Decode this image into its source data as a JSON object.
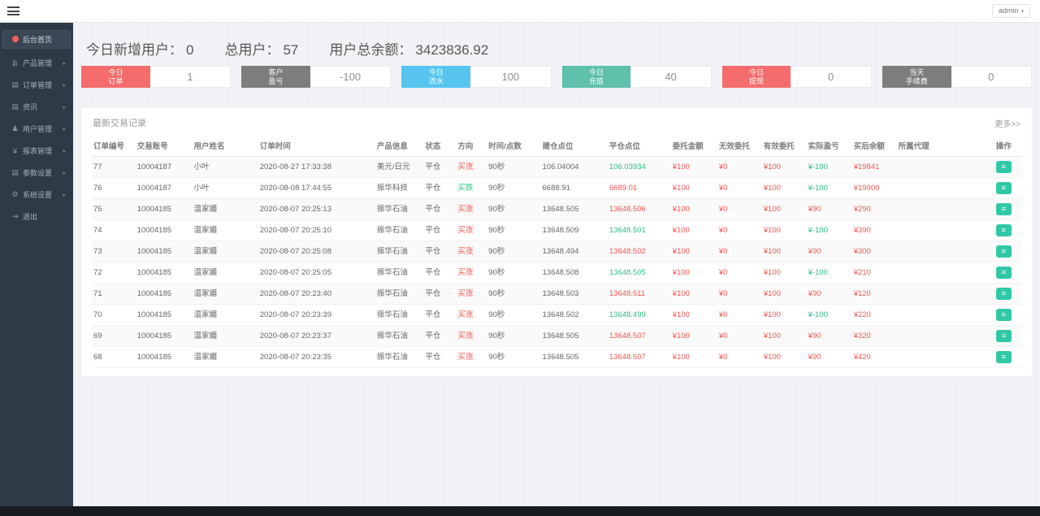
{
  "topbar": {
    "user_menu": "admin"
  },
  "sidebar": {
    "items": [
      {
        "label": "后台首页",
        "icon": "dashboard-icon",
        "glyph": "",
        "active": true,
        "has_children": false
      },
      {
        "label": "产品管理",
        "icon": "product-icon",
        "glyph": "Ƀ",
        "active": false,
        "has_children": true
      },
      {
        "label": "订单管理",
        "icon": "orders-icon",
        "glyph": "▤",
        "active": false,
        "has_children": true
      },
      {
        "label": "资讯",
        "icon": "news-icon",
        "glyph": "▤",
        "active": false,
        "has_children": true
      },
      {
        "label": "用户管理",
        "icon": "user-icon",
        "glyph": "♟",
        "active": false,
        "has_children": true
      },
      {
        "label": "报表管理",
        "icon": "report-yen-icon",
        "glyph": "¥",
        "active": false,
        "has_children": true
      },
      {
        "label": "参数设置",
        "icon": "params-icon",
        "glyph": "▤",
        "active": false,
        "has_children": true
      },
      {
        "label": "系统设置",
        "icon": "settings-gear-icon",
        "glyph": "⚙",
        "active": false,
        "has_children": true
      },
      {
        "label": "退出",
        "icon": "logout-icon",
        "glyph": "⇥",
        "active": false,
        "has_children": false
      }
    ]
  },
  "summary": {
    "items": [
      {
        "label": "今日新增用户：",
        "value": "0"
      },
      {
        "label": "总用户：",
        "value": "57"
      },
      {
        "label": "用户总余额：",
        "value": "3423836.92"
      }
    ]
  },
  "stat_cards": [
    {
      "name": "today-orders",
      "label_lines": [
        "今日",
        "订单"
      ],
      "value": "1",
      "color": "#f56c6c"
    },
    {
      "name": "customer-pnl",
      "label_lines": [
        "客户",
        "盈亏"
      ],
      "value": "-100",
      "color": "#7d7d7d"
    },
    {
      "name": "today-turnover",
      "label_lines": [
        "今日",
        "流水"
      ],
      "value": "100",
      "color": "#57c5f0"
    },
    {
      "name": "today-deposit",
      "label_lines": [
        "今日",
        "充值"
      ],
      "value": "40",
      "color": "#5fc0ab"
    },
    {
      "name": "today-withdrawal",
      "label_lines": [
        "今日",
        "提现"
      ],
      "value": "0",
      "color": "#f56c6c"
    },
    {
      "name": "today-fees",
      "label_lines": [
        "当天",
        "手续费"
      ],
      "value": "0",
      "color": "#7d7d7d"
    }
  ],
  "table": {
    "title": "最新交易记录",
    "more_label": "更多>>",
    "columns": [
      {
        "label": "订单编号",
        "w": "4.7%"
      },
      {
        "label": "交易账号",
        "w": "6.1%"
      },
      {
        "label": "用户姓名",
        "w": "7.1%"
      },
      {
        "label": "订单时间",
        "w": "12.6%"
      },
      {
        "label": "产品信息",
        "w": "5.2%"
      },
      {
        "label": "状态",
        "w": "3.5%"
      },
      {
        "label": "方向",
        "w": "3.3%"
      },
      {
        "label": "时间/点数",
        "w": "5.8%"
      },
      {
        "label": "建仓点位",
        "w": "7.2%"
      },
      {
        "label": "平仓点位",
        "w": "6.8%"
      },
      {
        "label": "委托金额",
        "w": "5.0%"
      },
      {
        "label": "无效委托",
        "w": "4.8%"
      },
      {
        "label": "有效委托",
        "w": "4.8%"
      },
      {
        "label": "实际盈亏",
        "w": "4.9%"
      },
      {
        "label": "买后余额",
        "w": "4.8%"
      },
      {
        "label": "所属代理",
        "w": "10.5%"
      },
      {
        "label": "操作",
        "w": "2.9%"
      }
    ],
    "action_icon": "order-detail-button",
    "rows": [
      {
        "cells": [
          {
            "v": "77"
          },
          {
            "v": "10004187"
          },
          {
            "v": "小叶"
          },
          {
            "v": "2020-08-27 17:33:38"
          },
          {
            "v": "美元/日元"
          },
          {
            "v": "平仓"
          },
          {
            "v": "买涨",
            "c": "red"
          },
          {
            "v": "90秒"
          },
          {
            "v": "106.04004"
          },
          {
            "v": "106.03934",
            "c": "green"
          },
          {
            "v": "¥100",
            "c": "red"
          },
          {
            "v": "¥0",
            "c": "red"
          },
          {
            "v": "¥100",
            "c": "red"
          },
          {
            "v": "¥-100",
            "c": "green"
          },
          {
            "v": "¥19841",
            "c": "red"
          },
          {
            "v": ""
          }
        ]
      },
      {
        "cells": [
          {
            "v": "76"
          },
          {
            "v": "10004187"
          },
          {
            "v": "小叶"
          },
          {
            "v": "2020-08-08 17:44:55"
          },
          {
            "v": "振华科技"
          },
          {
            "v": "平仓"
          },
          {
            "v": "买跌",
            "c": "green"
          },
          {
            "v": "90秒"
          },
          {
            "v": "6688.91"
          },
          {
            "v": "6689.01",
            "c": "red"
          },
          {
            "v": "¥100",
            "c": "red"
          },
          {
            "v": "¥0",
            "c": "red"
          },
          {
            "v": "¥100",
            "c": "red"
          },
          {
            "v": "¥-100",
            "c": "green"
          },
          {
            "v": "¥19900",
            "c": "red"
          },
          {
            "v": ""
          }
        ]
      },
      {
        "cells": [
          {
            "v": "75"
          },
          {
            "v": "10004185"
          },
          {
            "v": "温家媚"
          },
          {
            "v": "2020-08-07 20:25:13"
          },
          {
            "v": "振华石油"
          },
          {
            "v": "平仓"
          },
          {
            "v": "买涨",
            "c": "red"
          },
          {
            "v": "90秒"
          },
          {
            "v": "13648.505"
          },
          {
            "v": "13648.506",
            "c": "red"
          },
          {
            "v": "¥100",
            "c": "red"
          },
          {
            "v": "¥0",
            "c": "red"
          },
          {
            "v": "¥100",
            "c": "red"
          },
          {
            "v": "¥90",
            "c": "red"
          },
          {
            "v": "¥290",
            "c": "red"
          },
          {
            "v": ""
          }
        ]
      },
      {
        "cells": [
          {
            "v": "74"
          },
          {
            "v": "10004185"
          },
          {
            "v": "温家媚"
          },
          {
            "v": "2020-08-07 20:25:10"
          },
          {
            "v": "振华石油"
          },
          {
            "v": "平仓"
          },
          {
            "v": "买涨",
            "c": "red"
          },
          {
            "v": "90秒"
          },
          {
            "v": "13648.509"
          },
          {
            "v": "13648.501",
            "c": "green"
          },
          {
            "v": "¥100",
            "c": "red"
          },
          {
            "v": "¥0",
            "c": "red"
          },
          {
            "v": "¥100",
            "c": "red"
          },
          {
            "v": "¥-100",
            "c": "green"
          },
          {
            "v": "¥390",
            "c": "red"
          },
          {
            "v": ""
          }
        ]
      },
      {
        "cells": [
          {
            "v": "73"
          },
          {
            "v": "10004185"
          },
          {
            "v": "温家媚"
          },
          {
            "v": "2020-08-07 20:25:08"
          },
          {
            "v": "振华石油"
          },
          {
            "v": "平仓"
          },
          {
            "v": "买涨",
            "c": "red"
          },
          {
            "v": "90秒"
          },
          {
            "v": "13648.494"
          },
          {
            "v": "13648.502",
            "c": "red"
          },
          {
            "v": "¥100",
            "c": "red"
          },
          {
            "v": "¥0",
            "c": "red"
          },
          {
            "v": "¥100",
            "c": "red"
          },
          {
            "v": "¥90",
            "c": "red"
          },
          {
            "v": "¥300",
            "c": "red"
          },
          {
            "v": ""
          }
        ]
      },
      {
        "cells": [
          {
            "v": "72"
          },
          {
            "v": "10004185"
          },
          {
            "v": "温家媚"
          },
          {
            "v": "2020-08-07 20:25:05"
          },
          {
            "v": "振华石油"
          },
          {
            "v": "平仓"
          },
          {
            "v": "买涨",
            "c": "red"
          },
          {
            "v": "90秒"
          },
          {
            "v": "13648.508"
          },
          {
            "v": "13648.505",
            "c": "green"
          },
          {
            "v": "¥100",
            "c": "red"
          },
          {
            "v": "¥0",
            "c": "red"
          },
          {
            "v": "¥100",
            "c": "red"
          },
          {
            "v": "¥-100",
            "c": "green"
          },
          {
            "v": "¥210",
            "c": "red"
          },
          {
            "v": ""
          }
        ]
      },
      {
        "cells": [
          {
            "v": "71"
          },
          {
            "v": "10004185"
          },
          {
            "v": "温家媚"
          },
          {
            "v": "2020-08-07 20:23:40"
          },
          {
            "v": "振华石油"
          },
          {
            "v": "平仓"
          },
          {
            "v": "买涨",
            "c": "red"
          },
          {
            "v": "90秒"
          },
          {
            "v": "13648.503"
          },
          {
            "v": "13648.511",
            "c": "red"
          },
          {
            "v": "¥100",
            "c": "red"
          },
          {
            "v": "¥0",
            "c": "red"
          },
          {
            "v": "¥100",
            "c": "red"
          },
          {
            "v": "¥90",
            "c": "red"
          },
          {
            "v": "¥120",
            "c": "red"
          },
          {
            "v": ""
          }
        ]
      },
      {
        "cells": [
          {
            "v": "70"
          },
          {
            "v": "10004185"
          },
          {
            "v": "温家媚"
          },
          {
            "v": "2020-08-07 20:23:39"
          },
          {
            "v": "振华石油"
          },
          {
            "v": "平仓"
          },
          {
            "v": "买涨",
            "c": "red"
          },
          {
            "v": "90秒"
          },
          {
            "v": "13648.502"
          },
          {
            "v": "13648.499",
            "c": "green"
          },
          {
            "v": "¥100",
            "c": "red"
          },
          {
            "v": "¥0",
            "c": "red"
          },
          {
            "v": "¥100",
            "c": "red"
          },
          {
            "v": "¥-100",
            "c": "green"
          },
          {
            "v": "¥220",
            "c": "red"
          },
          {
            "v": ""
          }
        ]
      },
      {
        "cells": [
          {
            "v": "69"
          },
          {
            "v": "10004185"
          },
          {
            "v": "温家媚"
          },
          {
            "v": "2020-08-07 20:23:37"
          },
          {
            "v": "振华石油"
          },
          {
            "v": "平仓"
          },
          {
            "v": "买涨",
            "c": "red"
          },
          {
            "v": "90秒"
          },
          {
            "v": "13648.505"
          },
          {
            "v": "13648.507",
            "c": "red"
          },
          {
            "v": "¥100",
            "c": "red"
          },
          {
            "v": "¥0",
            "c": "red"
          },
          {
            "v": "¥100",
            "c": "red"
          },
          {
            "v": "¥90",
            "c": "red"
          },
          {
            "v": "¥320",
            "c": "red"
          },
          {
            "v": ""
          }
        ]
      },
      {
        "cells": [
          {
            "v": "68"
          },
          {
            "v": "10004185"
          },
          {
            "v": "温家媚"
          },
          {
            "v": "2020-08-07 20:23:35"
          },
          {
            "v": "振华石油"
          },
          {
            "v": "平仓"
          },
          {
            "v": "买涨",
            "c": "red"
          },
          {
            "v": "90秒"
          },
          {
            "v": "13648.505"
          },
          {
            "v": "13648.507",
            "c": "red"
          },
          {
            "v": "¥100",
            "c": "red"
          },
          {
            "v": "¥0",
            "c": "red"
          },
          {
            "v": "¥100",
            "c": "red"
          },
          {
            "v": "¥90",
            "c": "red"
          },
          {
            "v": "¥420",
            "c": "red"
          },
          {
            "v": ""
          }
        ]
      }
    ]
  },
  "colors": {
    "accent_red": "#f56c6c",
    "accent_gray": "#7d7d7d",
    "accent_blue": "#57c5f0",
    "accent_teal": "#5fc0ab",
    "text_red": "#f25555",
    "text_green": "#2fbe82",
    "action_button": "#30c9a5",
    "sidebar_bg": "#2e3a45"
  }
}
